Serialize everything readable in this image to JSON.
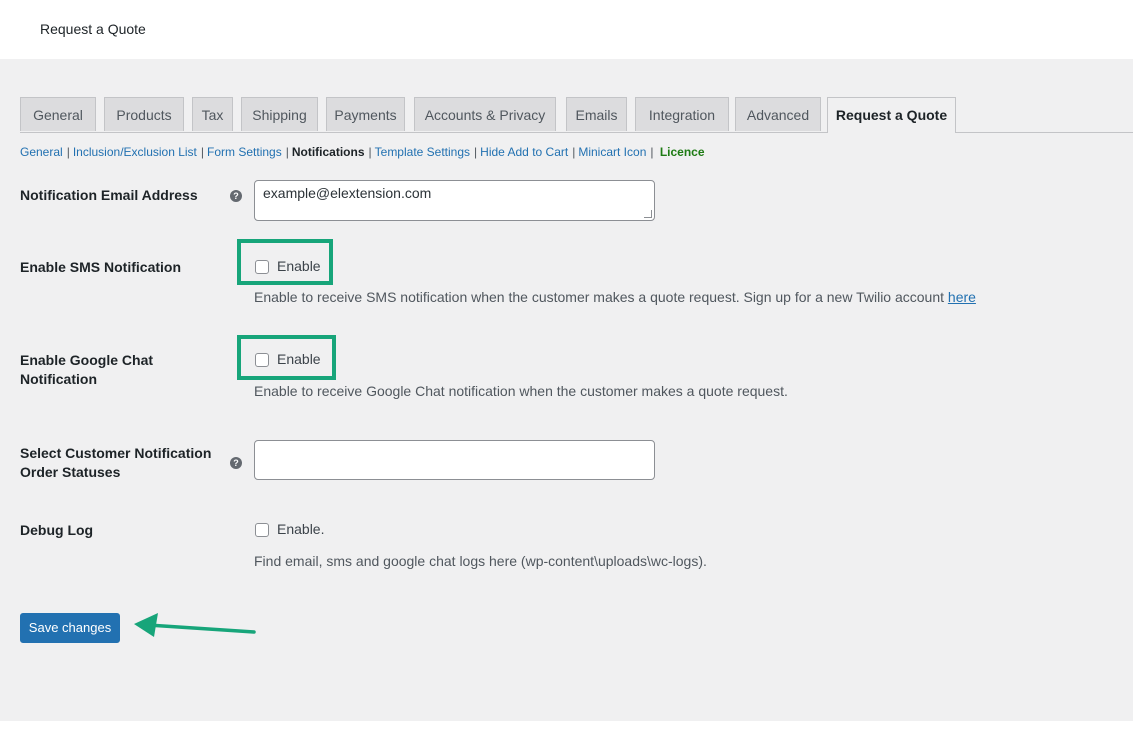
{
  "page": {
    "title": "Request a Quote"
  },
  "tabs": [
    {
      "label": "General"
    },
    {
      "label": "Products"
    },
    {
      "label": "Tax"
    },
    {
      "label": "Shipping"
    },
    {
      "label": "Payments"
    },
    {
      "label": "Accounts & Privacy"
    },
    {
      "label": "Emails"
    },
    {
      "label": "Integration"
    },
    {
      "label": "Advanced"
    },
    {
      "label": "Request a Quote",
      "active": true
    }
  ],
  "subnav": {
    "general": "General",
    "inclusion": "Inclusion/Exclusion List",
    "form": "Form Settings",
    "notifications": "Notifications",
    "template": "Template Settings",
    "hide_cart": "Hide Add to Cart",
    "minicart": "Minicart Icon",
    "licence": "Licence",
    "separator": "|"
  },
  "fields": {
    "email": {
      "label": "Notification Email Address",
      "value": "example@elextension.com"
    },
    "sms": {
      "label": "Enable SMS Notification",
      "checkbox_label": "Enable",
      "checked": false,
      "description": "Enable to receive SMS notification when the customer makes a quote request. Sign up for a new Twilio account",
      "link_text": "here"
    },
    "gchat": {
      "label": "Enable Google Chat Notification",
      "checkbox_label": "Enable",
      "checked": false,
      "description": "Enable to receive Google Chat notification when the customer makes a quote request."
    },
    "statuses": {
      "label": "Select Customer Notification Order Statuses",
      "value": ""
    },
    "debug": {
      "label": "Debug Log",
      "checkbox_label": "Enable.",
      "checked": false,
      "description": "Find email, sms and google chat logs here (wp-content\\uploads\\wc-logs)."
    }
  },
  "save_button": {
    "label": "Save changes"
  },
  "icons": {
    "help": "help-icon",
    "arrow": "arrow-left-icon",
    "resize": "resize-grip-icon"
  },
  "colors": {
    "accent": "#2271b1",
    "highlight": "#17a57a",
    "background": "#f0f0f1",
    "licence": "#1e7b14"
  }
}
